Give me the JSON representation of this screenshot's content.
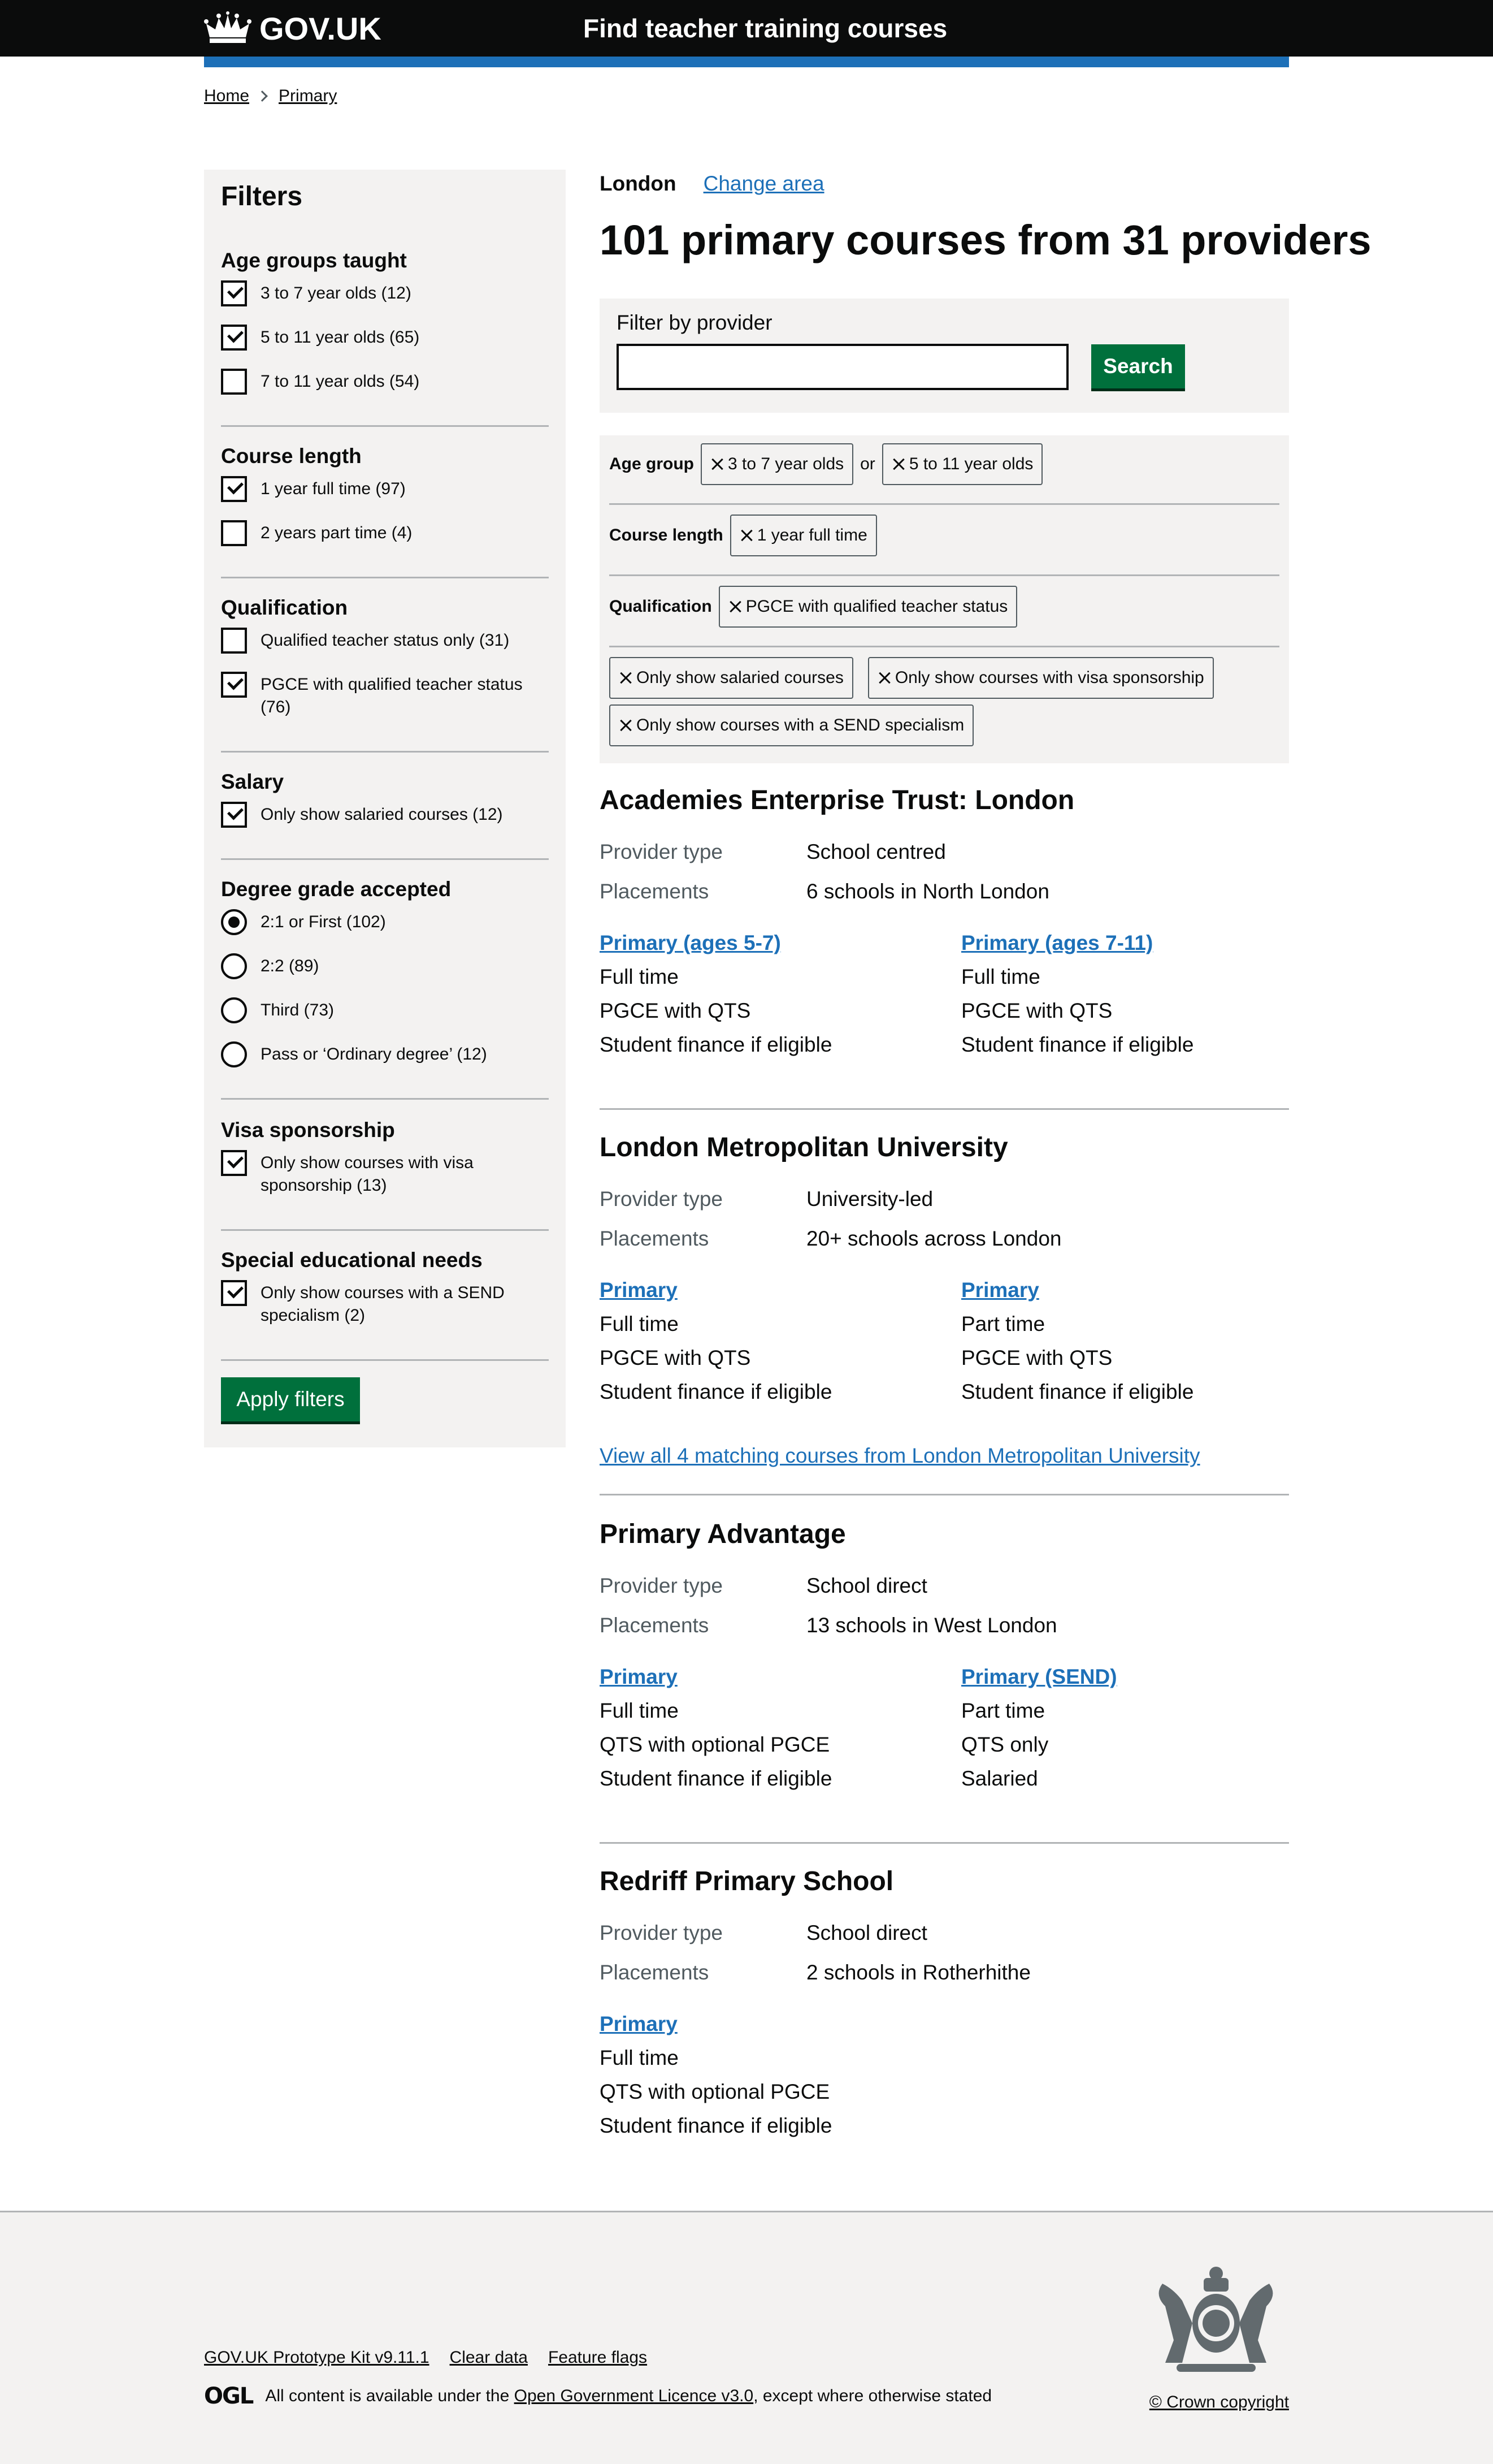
{
  "header": {
    "logo": "GOV.UK",
    "service": "Find teacher training courses",
    "brand_color": "#1d70b8"
  },
  "breadcrumbs": [
    "Home",
    "Primary"
  ],
  "filters": {
    "title": "Filters",
    "age_groups": {
      "title": "Age groups taught",
      "options": [
        {
          "label": "3 to 7 year olds (12)",
          "checked": true
        },
        {
          "label": "5 to 11 year olds (65)",
          "checked": true
        },
        {
          "label": "7 to 11 year olds (54)",
          "checked": false
        }
      ]
    },
    "course_length": {
      "title": "Course length",
      "options": [
        {
          "label": "1 year full time (97)",
          "checked": true
        },
        {
          "label": "2 years part time (4)",
          "checked": false
        }
      ]
    },
    "qualification": {
      "title": "Qualification",
      "options": [
        {
          "label": "Qualified teacher status only (31)",
          "checked": false
        },
        {
          "label": "PGCE with qualified teacher status (76)",
          "checked": true
        }
      ]
    },
    "salary": {
      "title": "Salary",
      "options": [
        {
          "label": "Only show salaried courses (12)",
          "checked": true
        }
      ]
    },
    "degree_grade": {
      "title": "Degree grade accepted",
      "options": [
        {
          "label": "2:1 or First (102)",
          "selected": true
        },
        {
          "label": "2:2 (89)",
          "selected": false
        },
        {
          "label": "Third (73)",
          "selected": false
        },
        {
          "label": "Pass or ‘Ordinary degree’ (12)",
          "selected": false
        }
      ]
    },
    "visa": {
      "title": "Visa sponsorship",
      "options": [
        {
          "label": "Only show courses with visa sponsorship (13)",
          "checked": true
        }
      ]
    },
    "send": {
      "title": "Special educational needs",
      "options": [
        {
          "label": "Only show courses with a SEND specialism (2)",
          "checked": true
        }
      ]
    },
    "apply_label": "Apply filters"
  },
  "main": {
    "area": "London",
    "change_area": "Change area",
    "results_title": "101 primary courses from 31 providers",
    "search": {
      "label": "Filter by provider",
      "placeholder": "",
      "button": "Search"
    },
    "applied": {
      "age_group_label": "Age group",
      "age_group_tags": [
        "3 to 7 year olds",
        "5 to 11 year olds"
      ],
      "or": "or",
      "course_length_label": "Course length",
      "course_length_tags": [
        "1 year full time"
      ],
      "qualification_label": "Qualification",
      "qualification_tags": [
        "PGCE with qualified teacher status"
      ],
      "other_tags": [
        "Only show salaried courses",
        "Only show courses with visa sponsorship",
        "Only show courses with a SEND specialism"
      ]
    },
    "providers": [
      {
        "name": "Academies Enterprise Trust: London",
        "provider_type_label": "Provider type",
        "provider_type": "School centred",
        "placements_label": "Placements",
        "placements": "6 schools in North London",
        "courses": [
          {
            "title": "Primary (ages 5-7)",
            "lines": [
              "Full time",
              "PGCE with QTS",
              "Student finance if eligible"
            ]
          },
          {
            "title": "Primary (ages 7-11)",
            "lines": [
              "Full time",
              "PGCE with QTS",
              "Student finance if eligible"
            ]
          }
        ]
      },
      {
        "name": "London Metropolitan University",
        "provider_type_label": "Provider type",
        "provider_type": "University-led",
        "placements_label": "Placements",
        "placements": "20+ schools across London",
        "courses": [
          {
            "title": "Primary",
            "lines": [
              "Full time",
              "PGCE with QTS",
              "Student finance if eligible"
            ]
          },
          {
            "title": "Primary",
            "lines": [
              "Part time",
              "PGCE with QTS",
              "Student finance if eligible"
            ]
          }
        ],
        "view_all": "View all 4 matching courses from London Metropolitan University"
      },
      {
        "name": "Primary Advantage",
        "provider_type_label": "Provider type",
        "provider_type": "School direct",
        "placements_label": "Placements",
        "placements": "13 schools in West London",
        "courses": [
          {
            "title": "Primary",
            "lines": [
              "Full time",
              "QTS with optional PGCE",
              "Student finance if eligible"
            ]
          },
          {
            "title": "Primary (SEND)",
            "lines": [
              "Part time",
              "QTS only",
              "Salaried"
            ]
          }
        ]
      },
      {
        "name": "Redriff Primary School",
        "provider_type_label": "Provider type",
        "provider_type": "School direct",
        "placements_label": "Placements",
        "placements": "2 schools in Rotherhithe",
        "courses": [
          {
            "title": "Primary",
            "lines": [
              "Full time",
              "QTS with optional PGCE",
              "Student finance if eligible"
            ]
          }
        ]
      }
    ]
  },
  "footer": {
    "links": [
      "GOV.UK Prototype Kit v9.11.1",
      "Clear data",
      "Feature flags"
    ],
    "ogl_logo": "OGL",
    "licence_prefix": "All content is available under the ",
    "licence_link": "Open Government Licence v3.0",
    "licence_suffix": ", except where otherwise stated",
    "copyright": "© Crown copyright"
  }
}
